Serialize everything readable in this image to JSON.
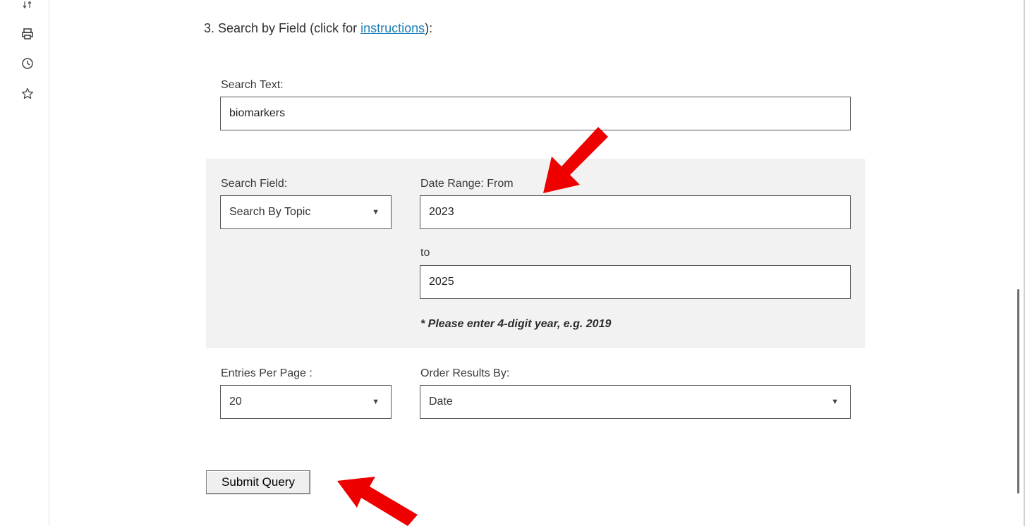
{
  "sidebar": {
    "icons": [
      "sort-icon",
      "printer-icon",
      "history-icon",
      "star-icon"
    ]
  },
  "heading": {
    "prefix": "3. Search by Field (click for ",
    "link": "instructions",
    "suffix": "):"
  },
  "search_text": {
    "label": "Search Text:",
    "value": "biomarkers"
  },
  "search_field": {
    "label": "Search Field:",
    "selected": "Search By Topic"
  },
  "date_range": {
    "from_label": "Date Range: From",
    "from_value": "2023",
    "to_label": "to",
    "to_value": "2025",
    "note": "* Please enter 4-digit year, e.g. 2019"
  },
  "entries_per_page": {
    "label": "Entries Per Page :",
    "selected": "20"
  },
  "order_by": {
    "label": "Order Results By:",
    "selected": "Date"
  },
  "submit": {
    "label": "Submit Query"
  },
  "colors": {
    "link": "#1f7fb8",
    "panel": "#f2f2f2",
    "annotation_arrow": "#ee0000"
  }
}
